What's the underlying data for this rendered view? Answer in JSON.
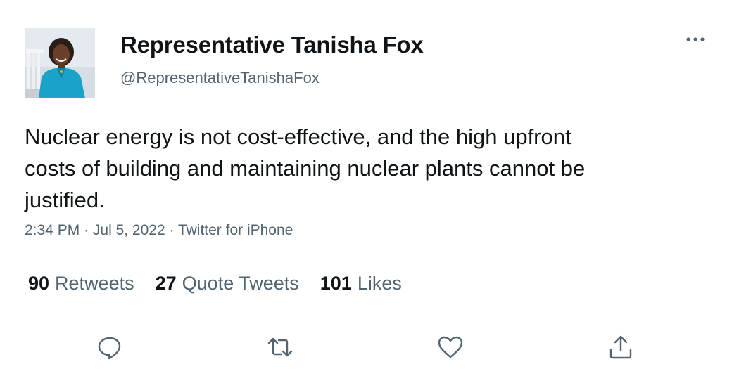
{
  "author": {
    "display_name": "Representative Tanisha Fox",
    "handle": "@RepresentativeTanishaFox",
    "avatar_icon": "profile-photo"
  },
  "tweet": {
    "text": "Nuclear energy is not cost-effective, and the high upfront costs of building and maintaining nuclear plants cannot be justified.",
    "time": "2:34 PM",
    "date": "Jul 5, 2022",
    "source": "Twitter for iPhone",
    "separator": " · "
  },
  "stats": {
    "retweets_count": "90",
    "retweets_label": "Retweets",
    "quotes_count": "27",
    "quotes_label": "Quote Tweets",
    "likes_count": "101",
    "likes_label": "Likes"
  },
  "actions": {
    "reply_icon": "reply-icon",
    "retweet_icon": "retweet-icon",
    "like_icon": "heart-icon",
    "share_icon": "share-icon",
    "more_icon": "more-options-icon"
  },
  "colors": {
    "text_primary": "#0f1419",
    "text_secondary": "#536471",
    "divider": "#cfd9de",
    "avatar_jacket": "#1aa3c8"
  }
}
